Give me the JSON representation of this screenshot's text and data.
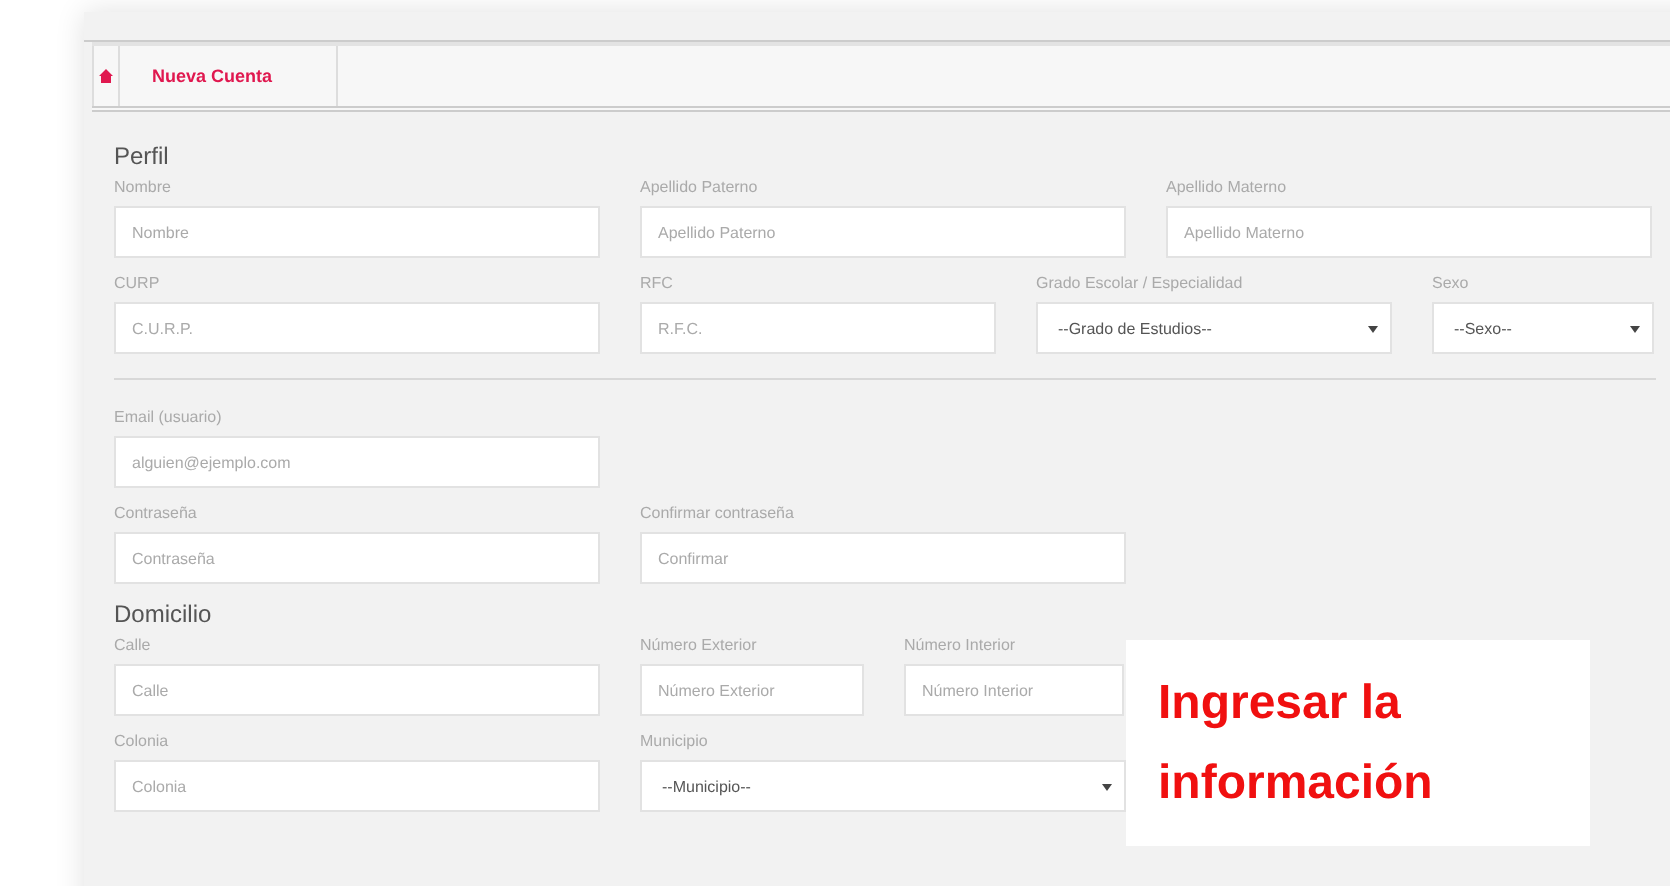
{
  "nav": {
    "items": [
      {
        "kind": "home"
      },
      {
        "kind": "link",
        "label": "Nueva Cuenta"
      }
    ]
  },
  "sections": [
    {
      "title": "Perfil",
      "rows": [
        [
          {
            "kind": "input",
            "label": "Nombre",
            "placeholder": "Nombre"
          },
          {
            "kind": "input",
            "label": "Apellido Paterno",
            "placeholder": "Apellido Paterno"
          },
          {
            "kind": "input",
            "label": "Apellido Materno",
            "placeholder": "Apellido Materno"
          }
        ],
        [
          {
            "kind": "input",
            "label": "CURP",
            "placeholder": "C.U.R.P."
          },
          {
            "kind": "input",
            "label": "RFC",
            "placeholder": "R.F.C."
          },
          {
            "kind": "select",
            "label": "Grado Escolar / Especialidad",
            "value": "--Grado de Estudios--"
          },
          {
            "kind": "select",
            "label": "Sexo",
            "value": "--Sexo--"
          }
        ],
        [
          {
            "kind": "divider"
          }
        ],
        [
          {
            "kind": "input",
            "label": "Email (usuario)",
            "placeholder": "alguien@ejemplo.com"
          }
        ],
        [
          {
            "kind": "input",
            "label": "Contraseña",
            "placeholder": "Contraseña"
          },
          {
            "kind": "input",
            "label": "Confirmar contraseña",
            "placeholder": "Confirmar"
          }
        ]
      ]
    },
    {
      "title": "Domicilio",
      "rows": [
        [
          {
            "kind": "input",
            "label": "Calle",
            "placeholder": "Calle"
          },
          {
            "kind": "input",
            "label": "Número Exterior",
            "placeholder": "Número Exterior"
          },
          {
            "kind": "input",
            "label": "Número Interior",
            "placeholder": "Número Interior"
          }
        ],
        [
          {
            "kind": "input",
            "label": "Colonia",
            "placeholder": "Colonia"
          },
          {
            "kind": "select",
            "label": "Municipio",
            "value": "--Municipio--"
          }
        ]
      ]
    }
  ],
  "callout": {
    "text": "Ingresar la información"
  }
}
